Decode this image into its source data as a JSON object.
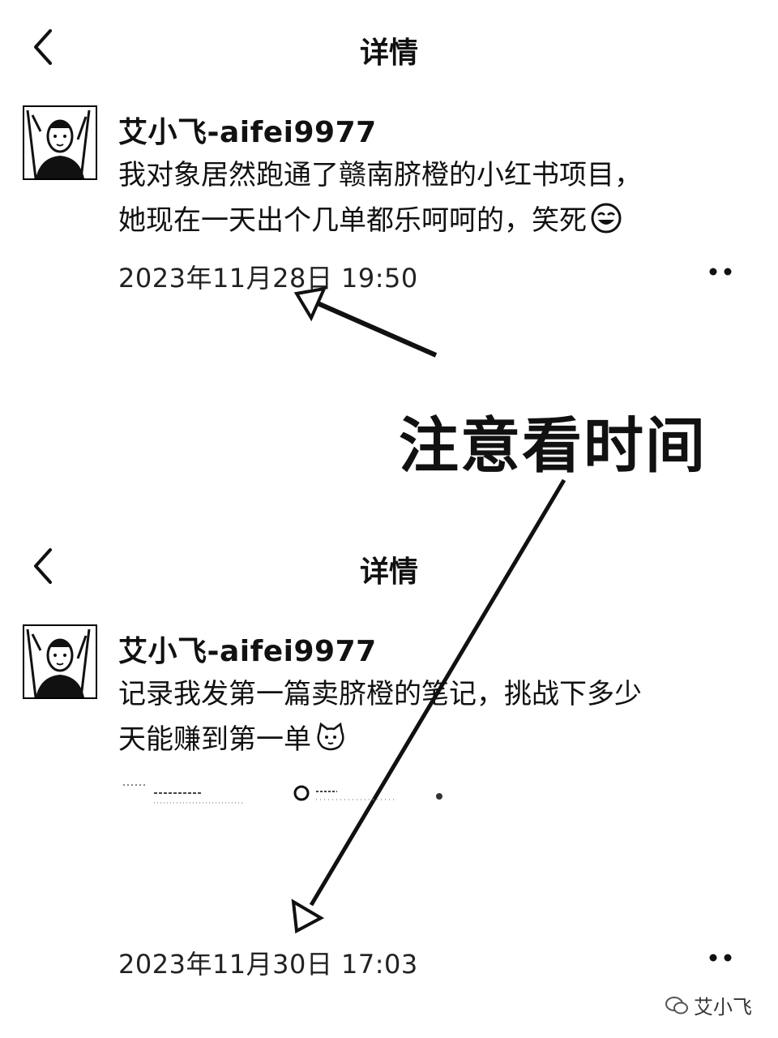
{
  "posts": [
    {
      "nav_title": "详情",
      "username": "艾小飞-aifei9977",
      "content_line1": "我对象居然跑通了赣南脐橙的小红书项目，",
      "content_line2": "她现在一天出个几单都乐呵呵的，笑死",
      "emoji_icon": "laughing-face-icon",
      "timestamp": "2023年11月28日 19:50"
    },
    {
      "nav_title": "详情",
      "username": "艾小飞-aifei9977",
      "content_line1": "记录我发第一篇卖脐橙的笔记，挑战下多少",
      "content_line2": "天能赚到第一单",
      "emoji_icon": "cat-face-icon",
      "timestamp": "2023年11月30日 17:03"
    }
  ],
  "annotation": {
    "text": "注意看时间"
  },
  "watermark": {
    "text": "艾小飞"
  }
}
